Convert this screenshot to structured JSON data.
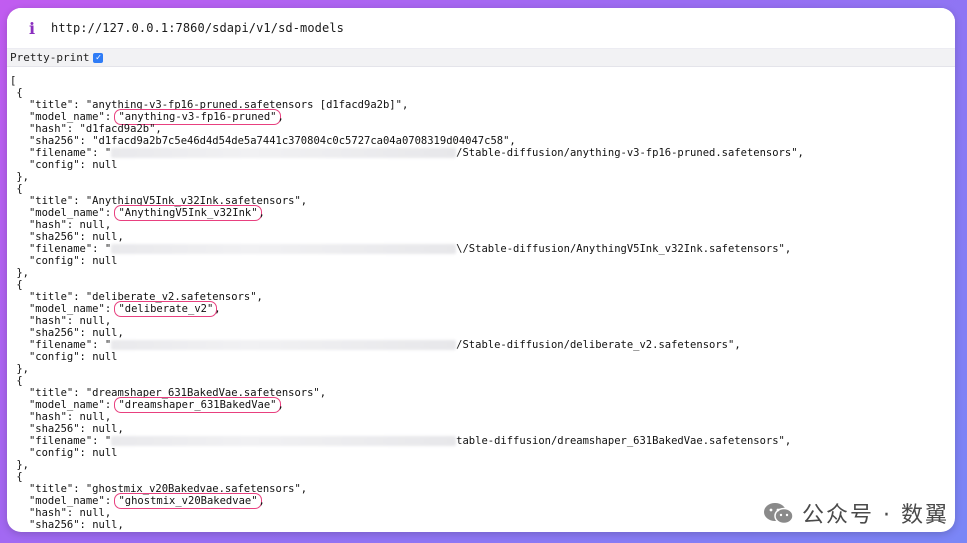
{
  "browser": {
    "info_glyph": "i",
    "url": "http://127.0.0.1:7860/sdapi/v1/sd-models"
  },
  "toolbar": {
    "pretty_print_label": "Pretty-print",
    "pretty_print_checked": true
  },
  "json": {
    "open_bracket": "[",
    "models": [
      {
        "title": "\"anything-v3-fp16-pruned.safetensors [d1facd9a2b]\"",
        "model_name": "\"anything-v3-fp16-pruned\"",
        "hash": "\"d1facd9a2b\"",
        "sha256": "\"d1facd9a2b7c5e46d4d54de5a7441c370804c0c5727ca04a0708319d04047c58\"",
        "filename_prefix": "\"",
        "filename_suffix": "/Stable-diffusion/anything-v3-fp16-pruned.safetensors\"",
        "config": "null"
      },
      {
        "title": "\"AnythingV5Ink_v32Ink.safetensors\"",
        "model_name": "\"AnythingV5Ink_v32Ink\"",
        "hash": "null",
        "sha256": "null",
        "filename_prefix": "\"",
        "filename_suffix": "\\/Stable-diffusion/AnythingV5Ink_v32Ink.safetensors\"",
        "config": "null"
      },
      {
        "title": "\"deliberate_v2.safetensors\"",
        "model_name": "\"deliberate_v2\"",
        "hash": "null",
        "sha256": "null",
        "filename_prefix": "\"",
        "filename_suffix": "/Stable-diffusion/deliberate_v2.safetensors\"",
        "config": "null"
      },
      {
        "title": "\"dreamshaper_631BakedVae.safetensors\"",
        "model_name": "\"dreamshaper_631BakedVae\"",
        "hash": "null",
        "sha256": "null",
        "filename_prefix": "\"",
        "filename_suffix": "table-diffusion/dreamshaper_631BakedVae.safetensors\"",
        "config": "null"
      },
      {
        "title": "\"ghostmix_v20Bakedvae.safetensors\"",
        "model_name": "\"ghostmix_v20Bakedvae\"",
        "hash": "null",
        "sha256": "null"
      }
    ]
  },
  "watermark": {
    "text": "公众号 · 数翼"
  }
}
